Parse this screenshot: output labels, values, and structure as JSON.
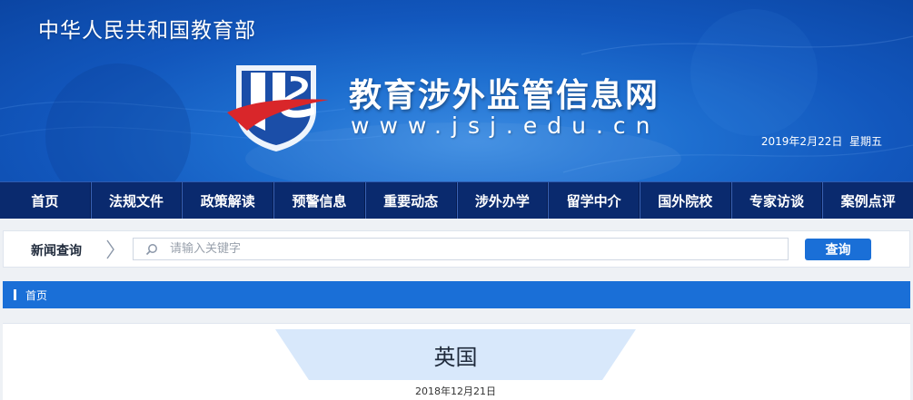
{
  "header": {
    "ministry": "中华人民共和国教育部",
    "site_title": "教育涉外监管信息网",
    "site_url": "www.jsj.edu.cn",
    "date": "2019年2月22日",
    "weekday": "星期五"
  },
  "nav": {
    "items": [
      {
        "label": "首页"
      },
      {
        "label": "法规文件"
      },
      {
        "label": "政策解读"
      },
      {
        "label": "预警信息"
      },
      {
        "label": "重要动态"
      },
      {
        "label": "涉外办学"
      },
      {
        "label": "留学中介"
      },
      {
        "label": "国外院校"
      },
      {
        "label": "专家访谈"
      },
      {
        "label": "案例点评"
      }
    ]
  },
  "search": {
    "label": "新闻查询",
    "placeholder": "请输入关键字",
    "value": "",
    "button_label": "查询"
  },
  "breadcrumb": {
    "home": "首页"
  },
  "article": {
    "title": "英国",
    "date": "2018年12月21日"
  },
  "colors": {
    "banner_blue": "#1257bd",
    "nav_bg": "#0a2a6e",
    "accent": "#1a6fd7",
    "logo_red": "#d9262a",
    "tab_bg": "#d8e8fb"
  },
  "icons": {
    "logo": "jsj-shield-logo",
    "search": "search-icon",
    "separator": "chevron-right-icon"
  }
}
